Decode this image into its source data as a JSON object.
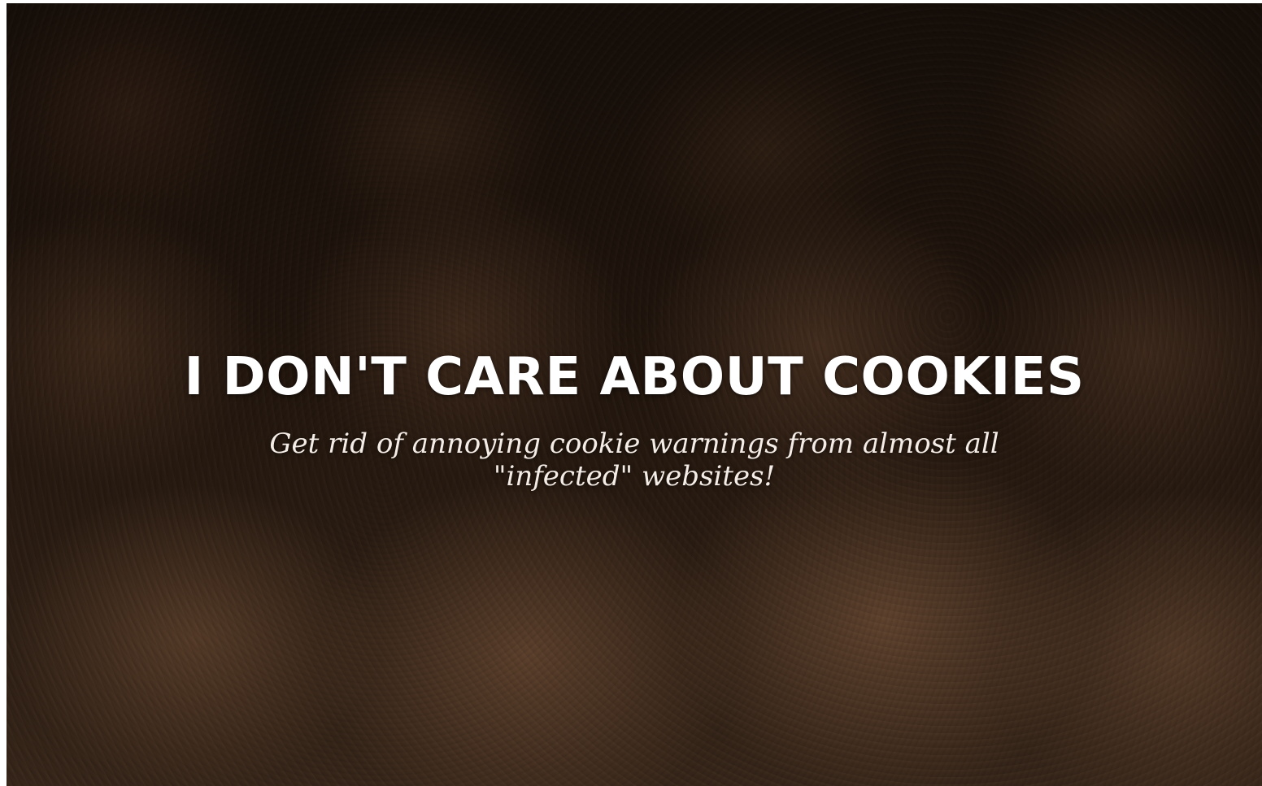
{
  "hero": {
    "title": "I DON'T CARE ABOUT COOKIES",
    "subtitle": "Get rid of annoying cookie warnings from almost all \"infected\" websites!",
    "background_image": "cookies-photo",
    "text_color": "#ffffff"
  }
}
